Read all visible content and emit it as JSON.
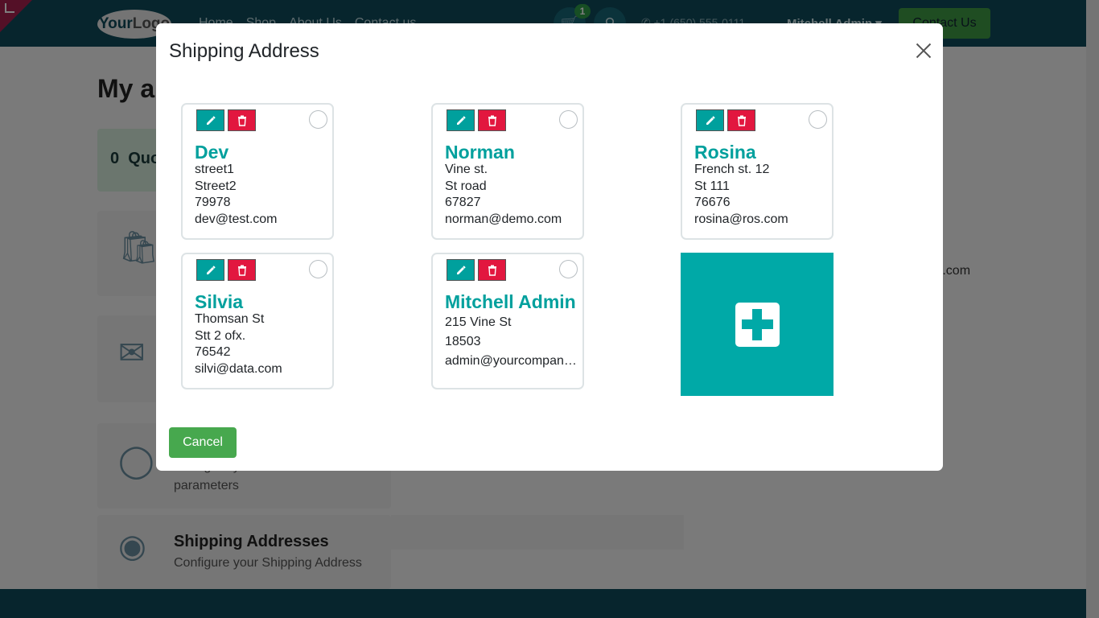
{
  "header": {
    "logo_text_a": "Your",
    "logo_text_b": "Logo",
    "nav": [
      "Home",
      "Shop",
      "About Us",
      "Contact us"
    ],
    "cart_count": "1",
    "phone": "+1 (650) 555-0111",
    "user": "Mitchell Admin",
    "contact_button": "Contact Us"
  },
  "page": {
    "title": "My a",
    "quotes_count": "0",
    "quotes_label": "Quo",
    "email_fragment": "ple.com",
    "tiles": [
      {
        "title": "",
        "desc": "Configure your connection parameters"
      },
      {
        "title": "Shipping Addresses",
        "desc": "Configure your Shipping Address"
      }
    ]
  },
  "modal": {
    "title": "Shipping Address",
    "cancel_label": "Cancel",
    "addresses": [
      {
        "name": "Dev",
        "lines": [
          "street1",
          "Street2",
          "79978",
          "dev@test.com"
        ]
      },
      {
        "name": "Norman",
        "lines": [
          "Vine st.",
          "St road",
          "67827",
          "norman@demo.com"
        ]
      },
      {
        "name": "Rosina",
        "lines": [
          "French st. 12",
          "St 111",
          "76676",
          "rosina@ros.com"
        ]
      },
      {
        "name": "Silvia",
        "lines": [
          "Thomsan St",
          "Stt 2 ofx.",
          "76542",
          "silvi@data.com"
        ]
      },
      {
        "name": "Mitchell Admin",
        "lines": [
          "215 Vine St",
          "18503",
          "admin@yourcompany.example.com"
        ]
      }
    ]
  },
  "colors": {
    "accent": "#00a09d",
    "danger": "#e2173f",
    "success": "#47a84e",
    "header_bg": "#0e4a5a"
  }
}
